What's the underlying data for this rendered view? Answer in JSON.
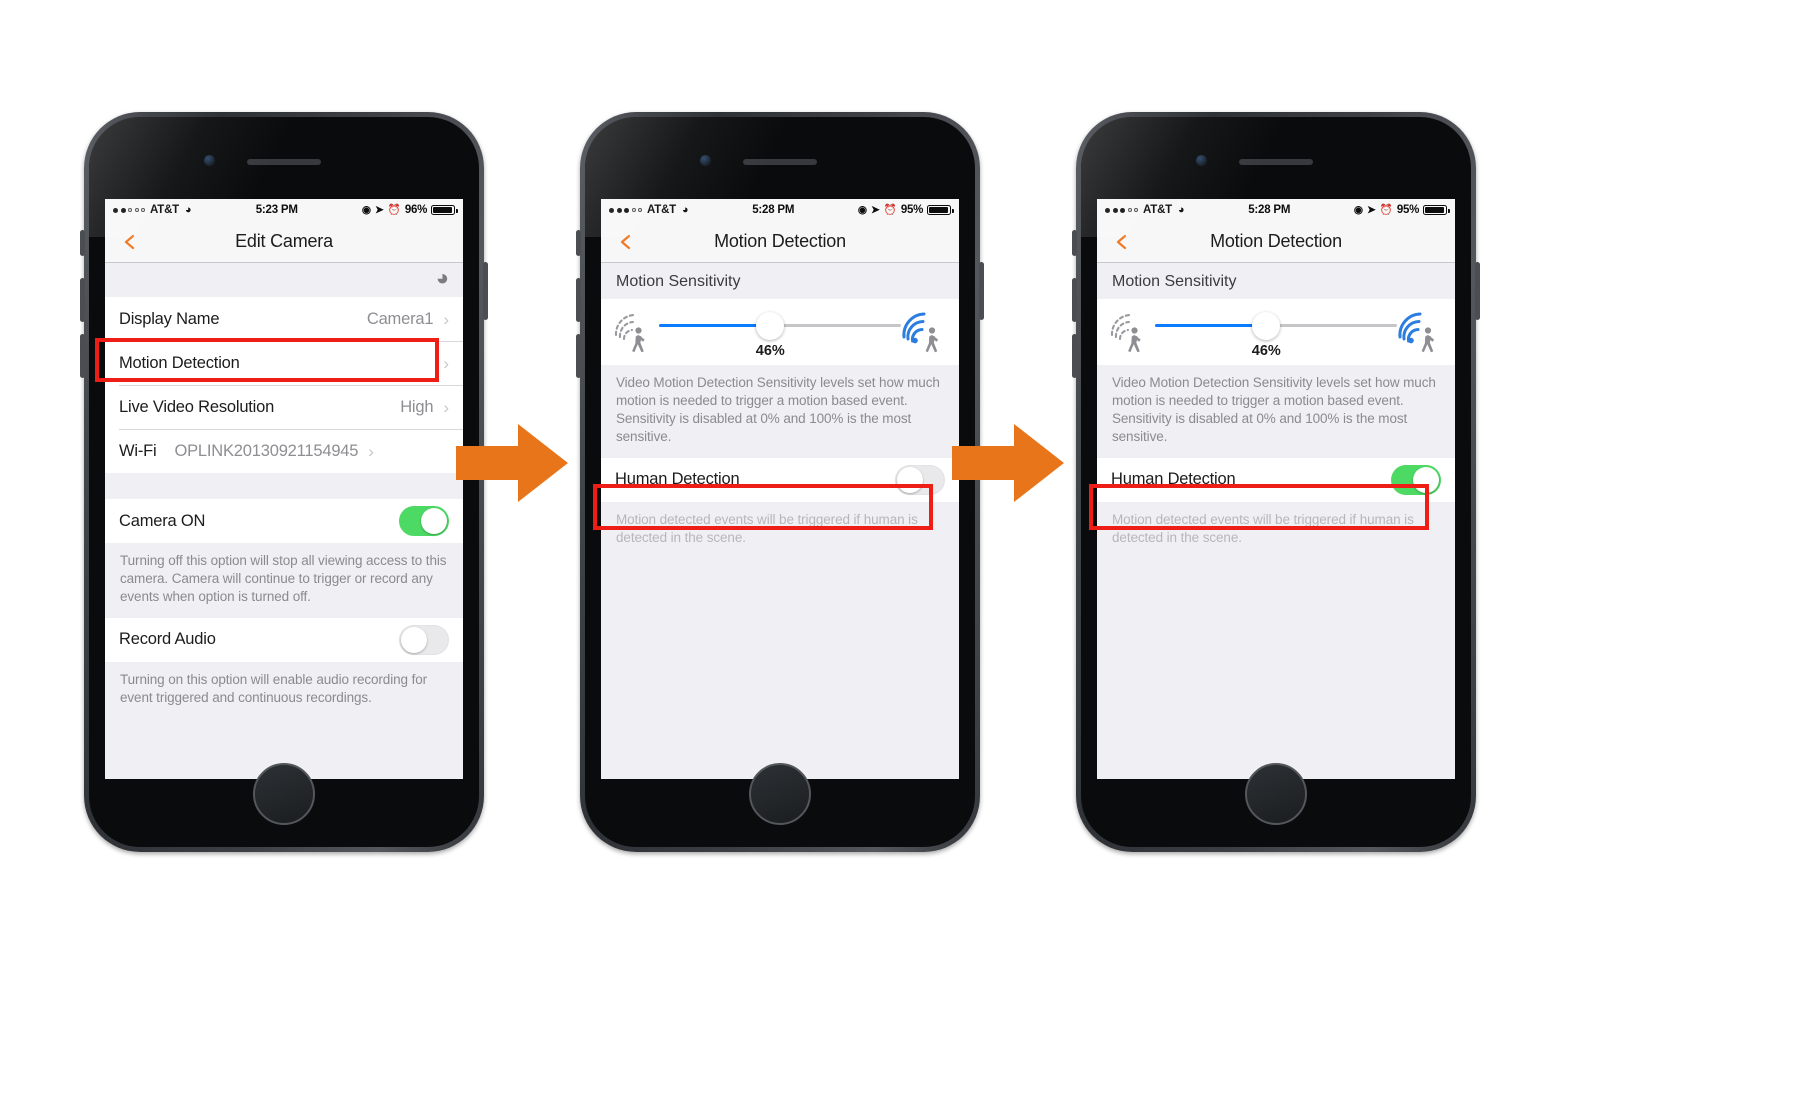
{
  "flow": {
    "arrow1_name": "step-arrow-1",
    "arrow2_name": "step-arrow-2",
    "accent_orange": "#e8751a",
    "highlight_red": "#ee1d15"
  },
  "phone1": {
    "status": {
      "signal_dots_filled": 2,
      "signal_dots_total": 5,
      "carrier": "AT&T",
      "wifi_icon": "wifi-icon",
      "time": "5:23 PM",
      "location_icon": "location-arrow-icon",
      "alarm_icon": "alarm-clock-icon",
      "rotation_icon": "rotation-lock-icon",
      "battery_percent": "96%",
      "battery_level": 96
    },
    "nav": {
      "back_icon": "back-chevron-icon",
      "title": "Edit Camera"
    },
    "wifi_strip_icon": "wifi-icon",
    "rows": [
      {
        "label": "Display Name",
        "value": "Camera1",
        "accessory": "chevron-right-icon"
      },
      {
        "label": "Motion Detection",
        "value": "",
        "accessory": "chevron-right-icon"
      },
      {
        "label": "Live Video Resolution",
        "value": "High",
        "accessory": "chevron-right-icon"
      },
      {
        "label": "Wi-Fi",
        "value": "OPLINK20130921154945",
        "accessory": "chevron-right-icon"
      }
    ],
    "camera_on": {
      "label": "Camera ON",
      "state": "on"
    },
    "camera_on_note": "Turning off this option will stop all viewing access to this camera. Camera will continue to trigger or record any events when option is turned off.",
    "record_audio": {
      "label": "Record Audio",
      "state": "off"
    },
    "record_audio_note": "Turning on this option will enable audio recording for event triggered and continuous recordings."
  },
  "phone2": {
    "status": {
      "signal_dots_filled": 3,
      "signal_dots_total": 5,
      "carrier": "AT&T",
      "wifi_icon": "wifi-icon",
      "time": "5:28 PM",
      "location_icon": "location-arrow-icon",
      "alarm_icon": "alarm-clock-icon",
      "rotation_icon": "rotation-lock-icon",
      "battery_percent": "95%",
      "battery_level": 95
    },
    "nav": {
      "back_icon": "back-chevron-icon",
      "title": "Motion Detection"
    },
    "section_header": "Motion Sensitivity",
    "slider": {
      "value": 46,
      "value_label": "46%",
      "min": 0,
      "max": 100,
      "left_icon": "low-sensitivity-person-icon",
      "right_icon": "high-sensitivity-person-icon",
      "fill_color": "#0a7cff"
    },
    "sensitivity_note": "Video Motion Detection Sensitivity levels set how much motion is needed to trigger a motion based event. Sensitivity is disabled at 0% and 100% is the most sensitive.",
    "human_detection": {
      "label": "Human Detection",
      "state": "off"
    },
    "human_detection_note": "Motion detected events will be triggered if human is detected in the scene."
  },
  "phone3": {
    "status": {
      "signal_dots_filled": 3,
      "signal_dots_total": 5,
      "carrier": "AT&T",
      "wifi_icon": "wifi-icon",
      "time": "5:28 PM",
      "location_icon": "location-arrow-icon",
      "alarm_icon": "alarm-clock-icon",
      "rotation_icon": "rotation-lock-icon",
      "battery_percent": "95%",
      "battery_level": 95
    },
    "nav": {
      "back_icon": "back-chevron-icon",
      "title": "Motion Detection"
    },
    "section_header": "Motion Sensitivity",
    "slider": {
      "value": 46,
      "value_label": "46%",
      "min": 0,
      "max": 100,
      "left_icon": "low-sensitivity-person-icon",
      "right_icon": "high-sensitivity-person-icon",
      "fill_color": "#0a7cff"
    },
    "sensitivity_note": "Video Motion Detection Sensitivity levels set how much motion is needed to trigger a motion based event. Sensitivity is disabled at 0% and 100% is the most sensitive.",
    "human_detection": {
      "label": "Human Detection",
      "state": "on"
    },
    "human_detection_note": "Motion detected events will be triggered if human is detected in the scene."
  }
}
